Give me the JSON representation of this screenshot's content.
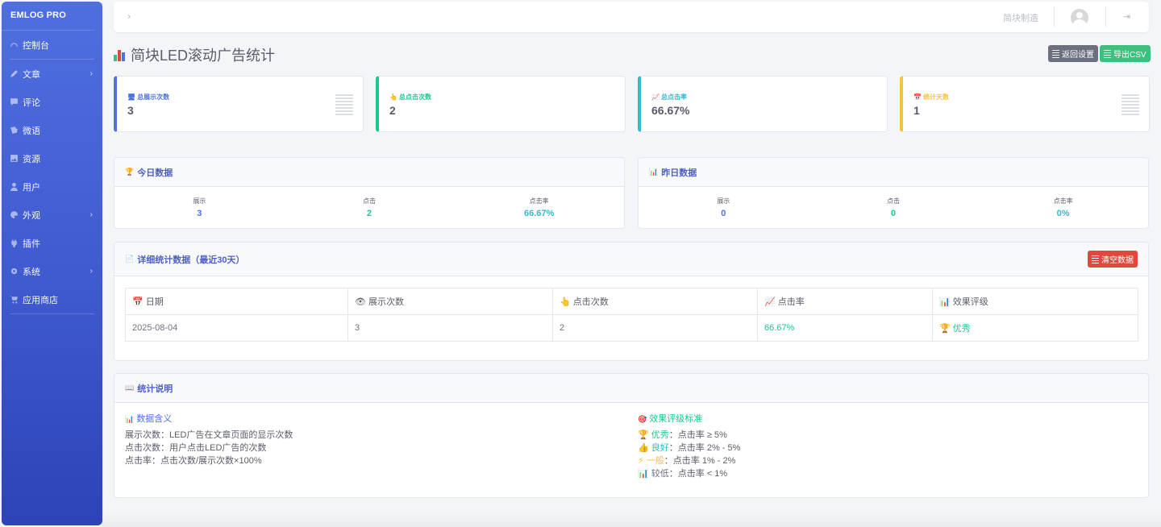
{
  "brand": "EMLOG PRO",
  "nav": [
    {
      "label": "控制台",
      "icon": "dashboard-icon",
      "chevron": ""
    },
    {
      "label": "文章",
      "icon": "pencil-icon",
      "chevron": "›"
    },
    {
      "label": "评论",
      "icon": "comment-icon",
      "chevron": ""
    },
    {
      "label": "微语",
      "icon": "twitter-icon",
      "chevron": ""
    },
    {
      "label": "资源",
      "icon": "image-icon",
      "chevron": ""
    },
    {
      "label": "用户",
      "icon": "user-icon",
      "chevron": ""
    },
    {
      "label": "外观",
      "icon": "palette-icon",
      "chevron": "›"
    },
    {
      "label": "插件",
      "icon": "plug-icon",
      "chevron": ""
    },
    {
      "label": "系统",
      "icon": "gear-icon",
      "chevron": "›"
    },
    {
      "label": "应用商店",
      "icon": "cart-icon",
      "chevron": ""
    }
  ],
  "topbar": {
    "toggle": "›",
    "site_name": "简块制造",
    "logout": "⇥"
  },
  "page": {
    "title": "简块LED滚动广告统计",
    "back_button": "返回设置",
    "export_button": "导出CSV"
  },
  "stats": [
    {
      "label": "总展示次数",
      "value": "3",
      "color": "#4e73df",
      "emoji": "🖥"
    },
    {
      "label": "总点击次数",
      "value": "2",
      "color": "#1cc88a",
      "emoji": "👆"
    },
    {
      "label": "总点击率",
      "value": "66.67%",
      "color": "#36b9cc",
      "emoji": "📈"
    },
    {
      "label": "统计天数",
      "value": "1",
      "color": "#f6c23e",
      "emoji": "📅"
    }
  ],
  "today": {
    "title": "今日数据",
    "items": [
      {
        "label": "展示",
        "value": "3",
        "color": "#4e73df"
      },
      {
        "label": "点击",
        "value": "2",
        "color": "#1cc88a"
      },
      {
        "label": "点击率",
        "value": "66.67%",
        "color": "#36b9cc"
      }
    ]
  },
  "yesterday": {
    "title": "昨日数据",
    "items": [
      {
        "label": "展示",
        "value": "0",
        "color": "#4e73df"
      },
      {
        "label": "点击",
        "value": "0",
        "color": "#1cc88a"
      },
      {
        "label": "点击率",
        "value": "0%",
        "color": "#36b9cc"
      }
    ]
  },
  "details": {
    "title": "详细统计数据（最近30天）",
    "clear_button": "清空数据",
    "columns": [
      "📅 日期",
      "👁 展示次数",
      "👆 点击次数",
      "📈 点击率",
      "📊 效果评级"
    ],
    "rows": [
      {
        "date": "2025-08-04",
        "views": "3",
        "clicks": "2",
        "rate": "66.67%",
        "rating": "🏆 优秀"
      }
    ]
  },
  "explain": {
    "title": "统计说明",
    "meaning_title": "数据含义",
    "meaning": [
      {
        "key": "展示次数：",
        "text": "LED广告在文章页面的显示次数"
      },
      {
        "key": "点击次数：",
        "text": "用户点击LED广告的次数"
      },
      {
        "key": "点击率：",
        "text": "点击次数/展示次数×100%"
      }
    ],
    "rating_title": "效果评级标准",
    "ratings": [
      {
        "key": "🏆 优秀",
        "text": "：点击率 ≥ 5%",
        "color": "#1cc88a"
      },
      {
        "key": "👍 良好",
        "text": "：点击率 2% - 5%",
        "color": "#36b9cc"
      },
      {
        "key": "⚡ 一般",
        "text": "：点击率 1% - 2%",
        "color": "#f6c23e"
      },
      {
        "key": "📊 较低",
        "text": "：点击率 < 1%",
        "color": "#6e707e"
      }
    ]
  }
}
